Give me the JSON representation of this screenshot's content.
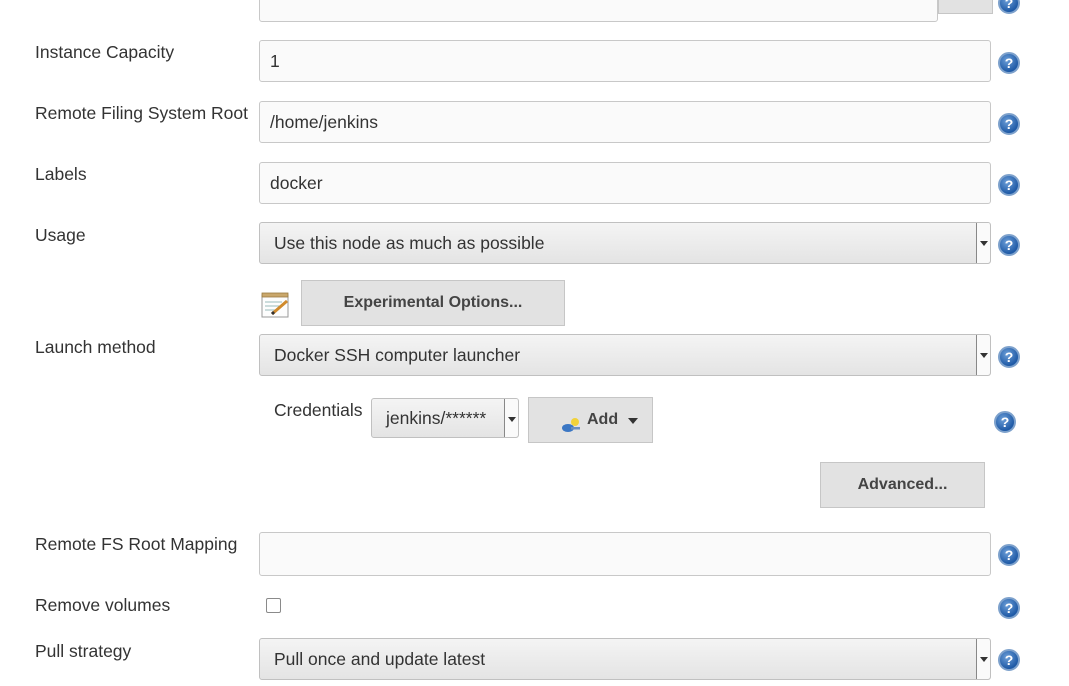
{
  "icons": {
    "help": "?"
  },
  "fields": {
    "top_partial": {
      "help": "?"
    },
    "instance_capacity": {
      "label": "Instance Capacity",
      "value": "1"
    },
    "remote_fs_root": {
      "label": "Remote Filing System Root",
      "value": "/home/jenkins"
    },
    "labels": {
      "label": "Labels",
      "value": "docker"
    },
    "usage": {
      "label": "Usage",
      "value": "Use this node as much as possible"
    },
    "experimental": {
      "button_label": "Experimental Options..."
    },
    "launch_method": {
      "label": "Launch method",
      "value": "Docker SSH computer launcher"
    },
    "credentials": {
      "label": "Credentials",
      "value": "jenkins/******",
      "add_label": "Add"
    },
    "advanced": {
      "button_label": "Advanced..."
    },
    "remote_fs_root_mapping": {
      "label": "Remote FS Root Mapping",
      "value": ""
    },
    "remove_volumes": {
      "label": "Remove volumes",
      "checked": false
    },
    "pull_strategy": {
      "label": "Pull strategy",
      "value": "Pull once and update latest"
    }
  }
}
